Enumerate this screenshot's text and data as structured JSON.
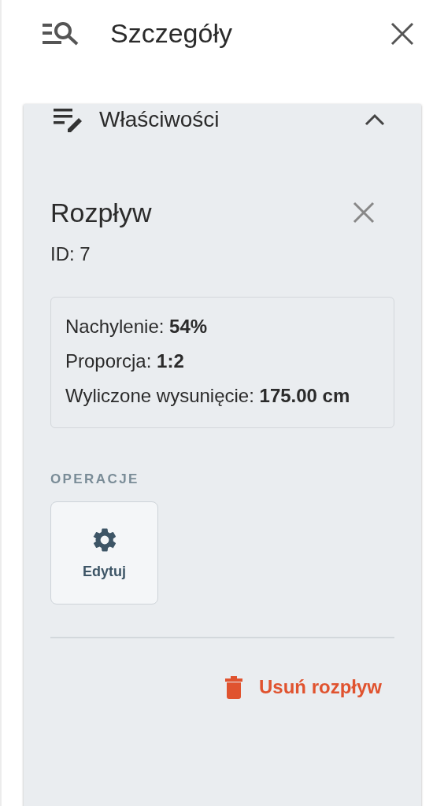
{
  "panel": {
    "title": "Szczegóły"
  },
  "section": {
    "label": "Właściwości",
    "expanded": true,
    "item": {
      "title": "Rozpływ",
      "id_text": "ID: 7",
      "properties": [
        "Nachylenie: **54%**",
        "Proporcja: **1:2**",
        "Wyliczone wysunięcie: **175.00 cm**"
      ],
      "operations_label": "OPERACJE",
      "operations": [
        {
          "label": "Edytuj"
        }
      ],
      "delete_label": "Usuń rozpływ"
    }
  }
}
